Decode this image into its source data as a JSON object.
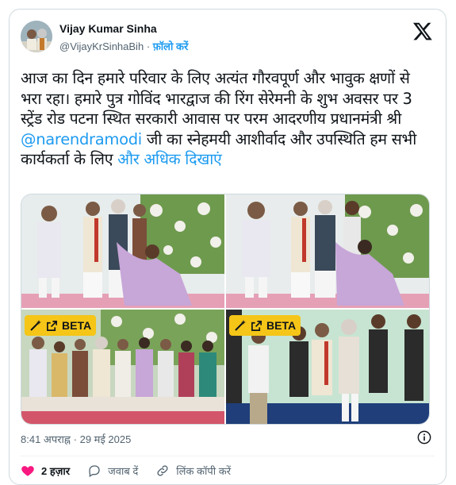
{
  "author": {
    "name": "Vijay Kumar Sinha",
    "handle": "@VijayKrSinhaBih",
    "separator": "·",
    "follow_label": "फ़ॉलो करें"
  },
  "tweet": {
    "text_before_mention": "आज का दिन हमारे परिवार के लिए अत्यंत गौरवपूर्ण और भावुक क्षणों से भरा रहा। हमारे पुत्र गोविंद भारद्वाज की रिंग सेरेमनी के शुभ अवसर पर 3 स्ट्रेंड रोड पटना स्थित सरकारी आवास पर परम आदरणीय प्रधानमंत्री श्री ",
    "mention": "@narendramodi",
    "text_after_mention": " जी का स्नेहमयी आशीर्वाद और उपस्थिति हम सभी कार्यकर्ता के लिए ",
    "show_more": "और अधिक दिखाएं"
  },
  "media": {
    "beta_label": "BETA"
  },
  "meta": {
    "time": "8:41 अपराह्न",
    "separator": "·",
    "date": "29 मई 2025"
  },
  "actions": {
    "likes": "2 हज़ार",
    "reply": "जवाब दें",
    "copy_link": "लिंक कॉपी करें"
  },
  "colors": {
    "accent": "#1d9bf0",
    "like": "#f91880",
    "beta_badge": "#f5c518"
  }
}
